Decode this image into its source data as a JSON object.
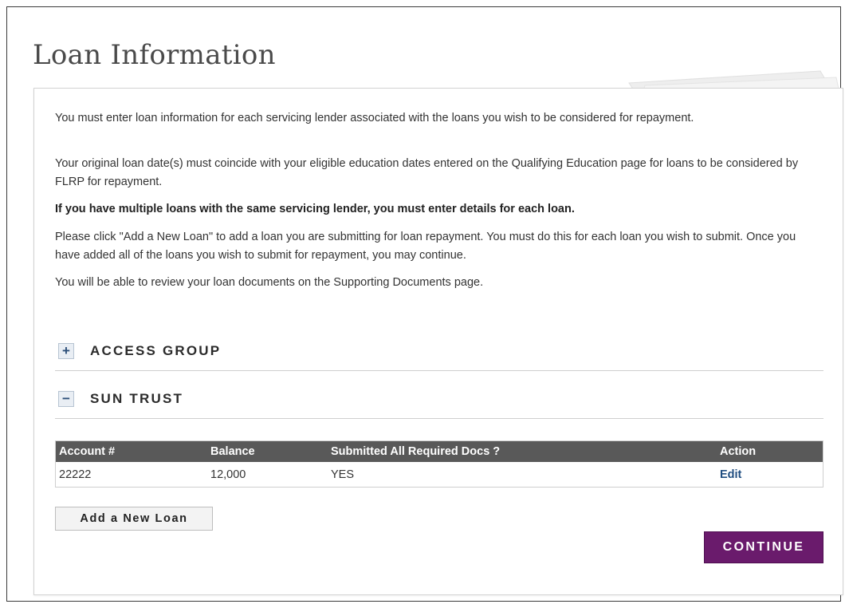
{
  "page": {
    "title": "Loan Information"
  },
  "instructions": {
    "p1": "You must enter loan information for each servicing lender associated with the loans you wish to be considered for repayment.",
    "p2": "Your original loan date(s) must coincide with your eligible education dates entered on the Qualifying Education page for loans to be considered by FLRP for repayment.",
    "p3": "If you have multiple loans with the same servicing lender, you must enter details for each loan.",
    "p4": "Please click \"Add a New Loan\" to add a loan you are submitting for loan repayment. You must do this for each loan you wish to submit. Once you have added all of the loans you wish to submit for repayment, you may continue.",
    "p5": "You will be able to review your loan documents on the Supporting Documents page."
  },
  "lenders": [
    {
      "name": "ACCESS GROUP",
      "toggle": "+",
      "expanded": false,
      "icon": "plus-icon"
    },
    {
      "name": "SUN TRUST",
      "toggle": "−",
      "expanded": true,
      "icon": "minus-icon"
    }
  ],
  "loan_table": {
    "headers": {
      "account": "Account #",
      "balance": "Balance",
      "docs": "Submitted All Required Docs ?",
      "action": "Action"
    },
    "rows": [
      {
        "account": "22222",
        "balance": "12,000",
        "docs": "YES",
        "action": "Edit"
      }
    ]
  },
  "buttons": {
    "add_loan": "Add a New Loan",
    "continue": "CONTINUE"
  },
  "colors": {
    "continue_bg": "#6a1b6c",
    "table_header_bg": "#595959",
    "link": "#1f4d80"
  }
}
